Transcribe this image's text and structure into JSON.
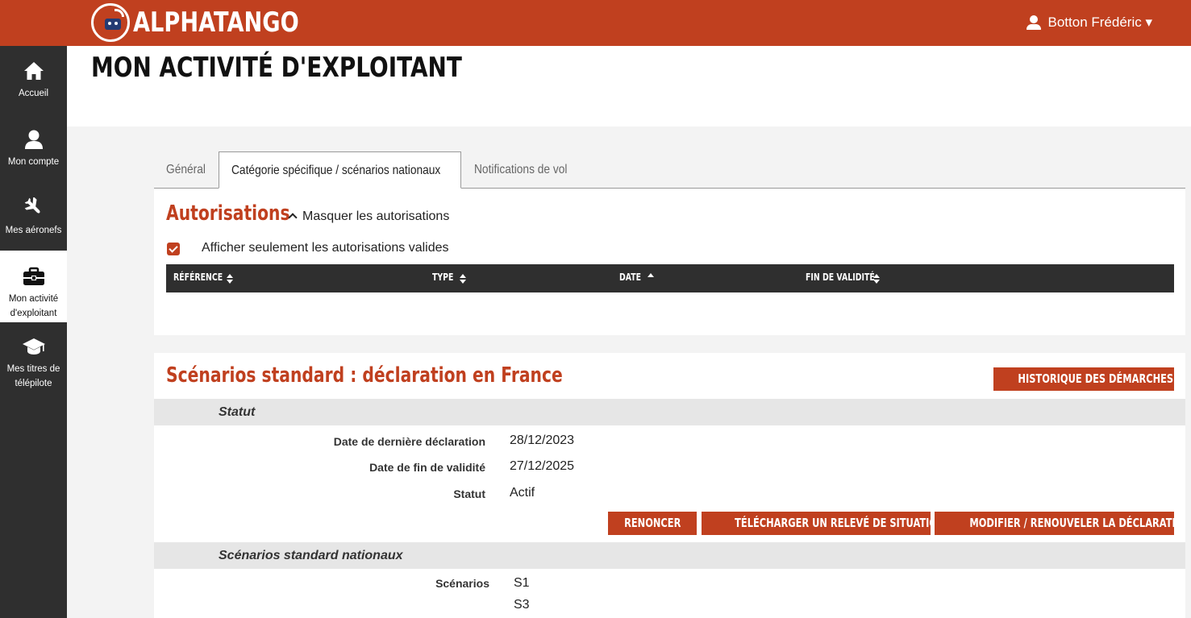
{
  "header": {
    "logo_text": "ALPHATANGO",
    "user_name": "Botton Frédéric ▾"
  },
  "sidebar": {
    "items": [
      {
        "label": "Accueil",
        "icon": "home-icon"
      },
      {
        "label": "Mon compte",
        "icon": "user-icon"
      },
      {
        "label": "Mes aéronefs",
        "icon": "airplane-icon"
      },
      {
        "label": "Mon activité d'exploitant",
        "icon": "briefcase-icon"
      },
      {
        "label": "Mes titres de télépilote",
        "icon": "graduation-cap-icon"
      }
    ]
  },
  "page": {
    "title": "MON ACTIVITÉ D'EXPLOITANT"
  },
  "tabs": [
    {
      "label": "Général"
    },
    {
      "label": "Catégorie spécifique / scénarios nationaux",
      "active": true
    },
    {
      "label": "Notifications de vol"
    }
  ],
  "autorisations": {
    "title": "Autorisations",
    "toggle_label": "Masquer les autorisations",
    "checkbox_label": "Afficher seulement les autorisations valides",
    "checkbox_checked": true,
    "columns": [
      "RÉFÉRENCE",
      "TYPE",
      "DATE",
      "FIN DE VALIDITÉ"
    ]
  },
  "declaration": {
    "title": "Scénarios standard : déclaration en France",
    "history_button": "HISTORIQUE DES DÉMARCHES",
    "statut_section": "Statut",
    "fields": [
      {
        "label": "Date de dernière déclaration",
        "value": "28/12/2023"
      },
      {
        "label": "Date de fin de validité",
        "value": "27/12/2025"
      },
      {
        "label": "Statut",
        "value": "Actif"
      }
    ],
    "buttons": {
      "renounce": "RENONCER",
      "download": "TÉLÉCHARGER UN RELEVÉ DE SITUATION",
      "modify": "MODIFIER / RENOUVELER LA DÉCLARATION"
    },
    "scenarios_section": "Scénarios standard nationaux",
    "scenarios_label": "Scénarios",
    "scenarios": [
      "S1",
      "S3"
    ]
  },
  "colors": {
    "brand": "#c0401f",
    "sidebar": "#2f2f2f",
    "content_bg": "#f3f3f3"
  }
}
